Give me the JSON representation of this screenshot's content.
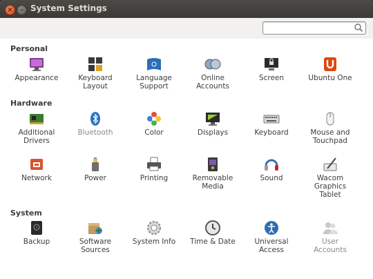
{
  "window": {
    "title": "System Settings"
  },
  "search": {
    "value": "",
    "placeholder": ""
  },
  "sections": {
    "personal": "Personal",
    "hardware": "Hardware",
    "system": "System"
  },
  "personal": [
    {
      "label": "Appearance",
      "icon": "appearance-icon"
    },
    {
      "label": "Keyboard\nLayout",
      "icon": "keyboard-layout-icon"
    },
    {
      "label": "Language\nSupport",
      "icon": "language-support-icon"
    },
    {
      "label": "Online\nAccounts",
      "icon": "online-accounts-icon"
    },
    {
      "label": "Screen",
      "icon": "screen-lock-icon"
    },
    {
      "label": "Ubuntu One",
      "icon": "ubuntu-one-icon"
    }
  ],
  "hardware": [
    {
      "label": "Additional\nDrivers",
      "icon": "additional-drivers-icon"
    },
    {
      "label": "Bluetooth",
      "icon": "bluetooth-icon",
      "dim": true
    },
    {
      "label": "Color",
      "icon": "color-icon"
    },
    {
      "label": "Displays",
      "icon": "displays-icon"
    },
    {
      "label": "Keyboard",
      "icon": "keyboard-icon"
    },
    {
      "label": "Mouse and\nTouchpad",
      "icon": "mouse-icon"
    },
    {
      "label": "Network",
      "icon": "network-icon"
    },
    {
      "label": "Power",
      "icon": "power-icon"
    },
    {
      "label": "Printing",
      "icon": "printer-icon"
    },
    {
      "label": "Removable\nMedia",
      "icon": "removable-media-icon"
    },
    {
      "label": "Sound",
      "icon": "sound-icon"
    },
    {
      "label": "Wacom\nGraphics\nTablet",
      "icon": "wacom-tablet-icon"
    }
  ],
  "system": [
    {
      "label": "Backup",
      "icon": "backup-icon"
    },
    {
      "label": "Software\nSources",
      "icon": "software-sources-icon"
    },
    {
      "label": "System Info",
      "icon": "system-info-icon"
    },
    {
      "label": "Time & Date",
      "icon": "clock-icon"
    },
    {
      "label": "Universal\nAccess",
      "icon": "universal-access-icon"
    },
    {
      "label": "User\nAccounts",
      "icon": "user-accounts-icon",
      "dim": true
    }
  ]
}
